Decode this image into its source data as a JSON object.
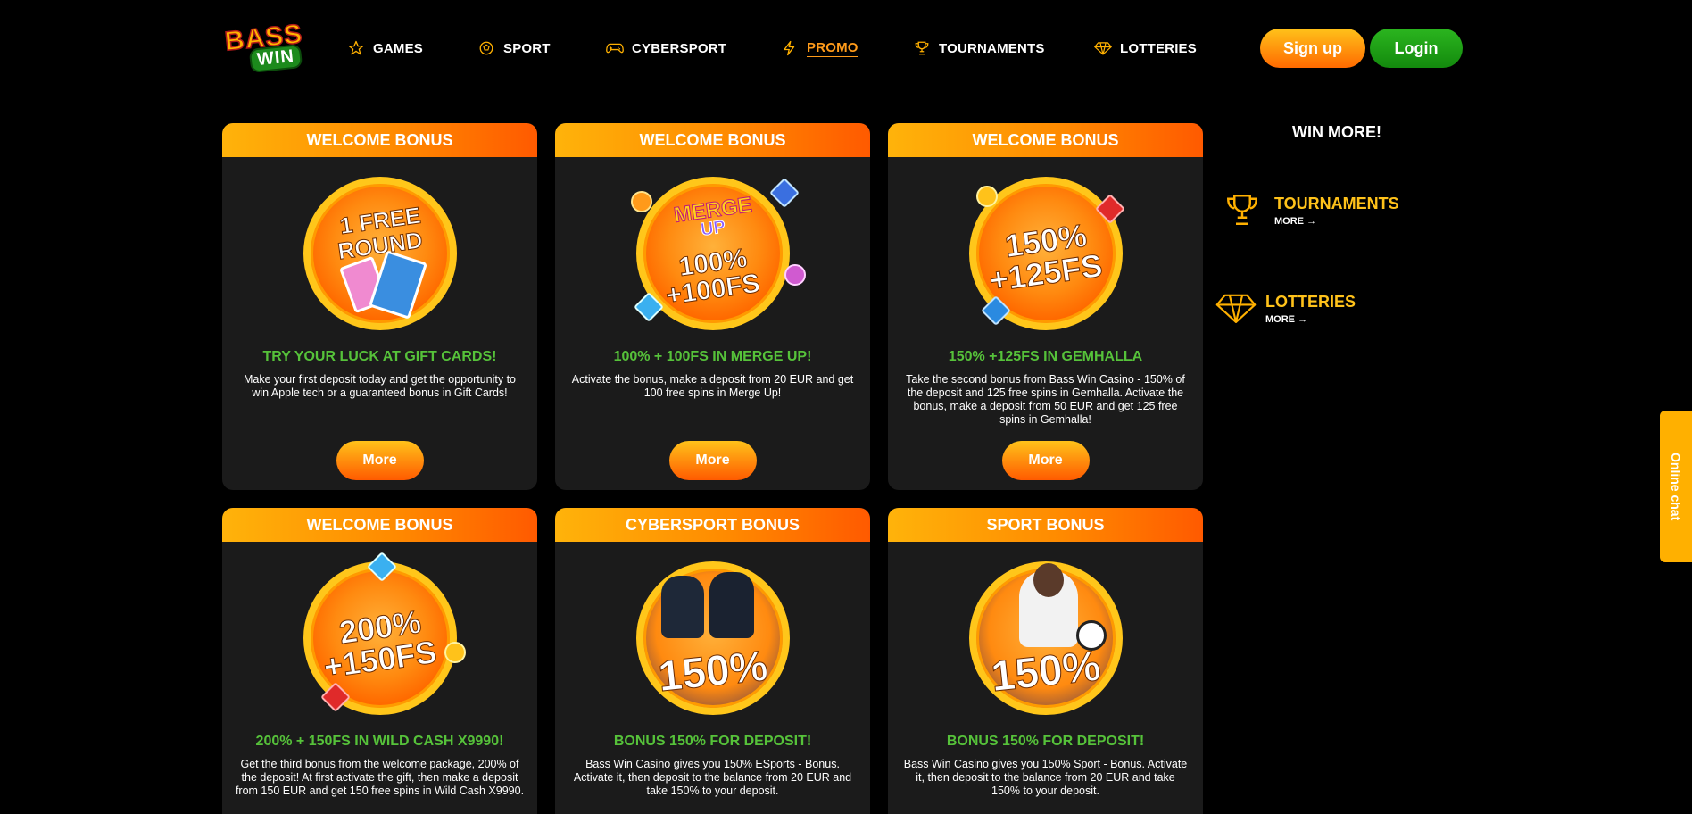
{
  "brand": {
    "logo_top": "BASS",
    "logo_bottom": "WIN"
  },
  "nav": [
    {
      "label": "GAMES",
      "icon": "star-icon"
    },
    {
      "label": "SPORT",
      "icon": "soccer-ball-icon"
    },
    {
      "label": "CYBERSPORT",
      "icon": "gamepad-icon"
    },
    {
      "label": "PROMO",
      "icon": "lightning-icon",
      "active": true
    },
    {
      "label": "TOURNAMENTS",
      "icon": "trophy-icon"
    },
    {
      "label": "LOTTERIES",
      "icon": "diamond-icon"
    }
  ],
  "auth": {
    "signup": "Sign up",
    "login": "Login"
  },
  "cards": [
    {
      "header": "WELCOME BONUS",
      "art_lines": [
        "1 FREE",
        "ROUND"
      ],
      "title": "TRY YOUR LUCK AT GIFT CARDS!",
      "description": "Make your first deposit today and get the opportunity to win Apple tech or a guaranteed bonus in Gift Cards!",
      "button": "More"
    },
    {
      "header": "WELCOME BONUS",
      "art_lines": [
        "MERGE",
        "UP",
        "100%",
        "+100FS"
      ],
      "title": "100% + 100FS IN MERGE UP!",
      "description": "Activate the bonus, make a deposit from 20 EUR and get 100 free spins in Merge Up!",
      "button": "More"
    },
    {
      "header": "WELCOME BONUS",
      "art_lines": [
        "150%",
        "+125FS"
      ],
      "title": "150% +125FS IN GEMHALLA",
      "description": "Take the second bonus from Bass Win Casino - 150% of the deposit and 125 free spins in Gemhalla. Activate the bonus, make a deposit from 50 EUR and get 125 free spins in Gemhalla!",
      "button": "More"
    },
    {
      "header": "WELCOME BONUS",
      "art_lines": [
        "200%",
        "+150FS"
      ],
      "title": "200% + 150FS IN WILD CASH X9990!",
      "description": "Get the third bonus from the welcome package, 200% of the deposit! At first activate the gift, then make a deposit from 150 EUR and get 150 free spins in Wild Cash X9990."
    },
    {
      "header": "CYBERSPORT BONUS",
      "art_lines": [
        "150%"
      ],
      "title": "BONUS 150% FOR DEPOSIT!",
      "description": "Bass Win Casino gives you 150% ESports - Bonus. Activate it, then deposit to the balance from 20 EUR and take 150% to your deposit."
    },
    {
      "header": "SPORT BONUS",
      "art_lines": [
        "150%"
      ],
      "title": "BONUS 150% FOR DEPOSIT!",
      "description": "Bass Win Casino gives you 150% Sport - Bonus. Activate it, then deposit to the balance from 20 EUR and take 150% to your deposit."
    }
  ],
  "sidebar": {
    "title": "WIN MORE!",
    "items": [
      {
        "label": "TOURNAMENTS",
        "more": "MORE",
        "icon": "trophy-icon"
      },
      {
        "label": "LOTTERIES",
        "more": "MORE",
        "icon": "diamond-icon"
      }
    ]
  },
  "chat": {
    "label": "Online chat"
  },
  "colors": {
    "accent_orange": "#ff8a00",
    "accent_yellow": "#ffc21a",
    "title_green": "#56c23a",
    "login_green": "#1f9e14",
    "card_bg": "#1b1b1b"
  }
}
